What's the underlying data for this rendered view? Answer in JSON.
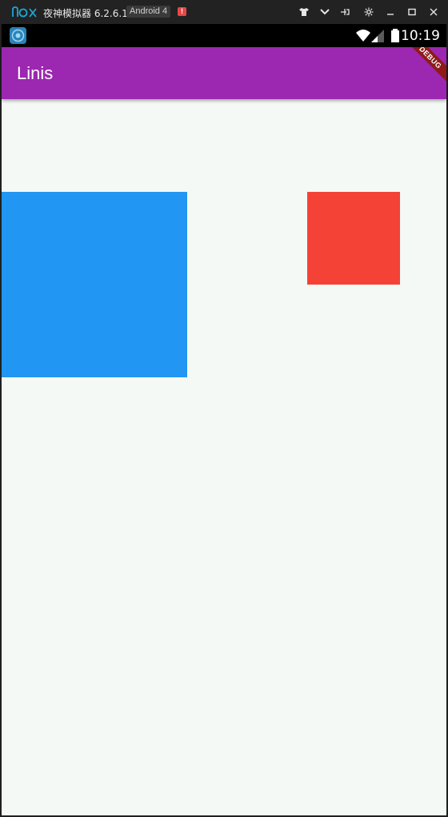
{
  "emulator": {
    "title": "夜神模拟器 6.2.6.1",
    "badge": "Android 4",
    "alert": "!",
    "controls": [
      "shirt-icon",
      "chevron-down-icon",
      "pin-icon",
      "gear-icon",
      "minimize-icon",
      "maximize-icon",
      "close-icon"
    ]
  },
  "status_bar": {
    "time": "10:19"
  },
  "app_bar": {
    "title": "Linis",
    "debug_banner": "DEBUG",
    "color": "#9c27b0"
  },
  "content": {
    "background": "#f5f9f6",
    "blue_box_color": "#2196f3",
    "red_box_color": "#f44336"
  }
}
